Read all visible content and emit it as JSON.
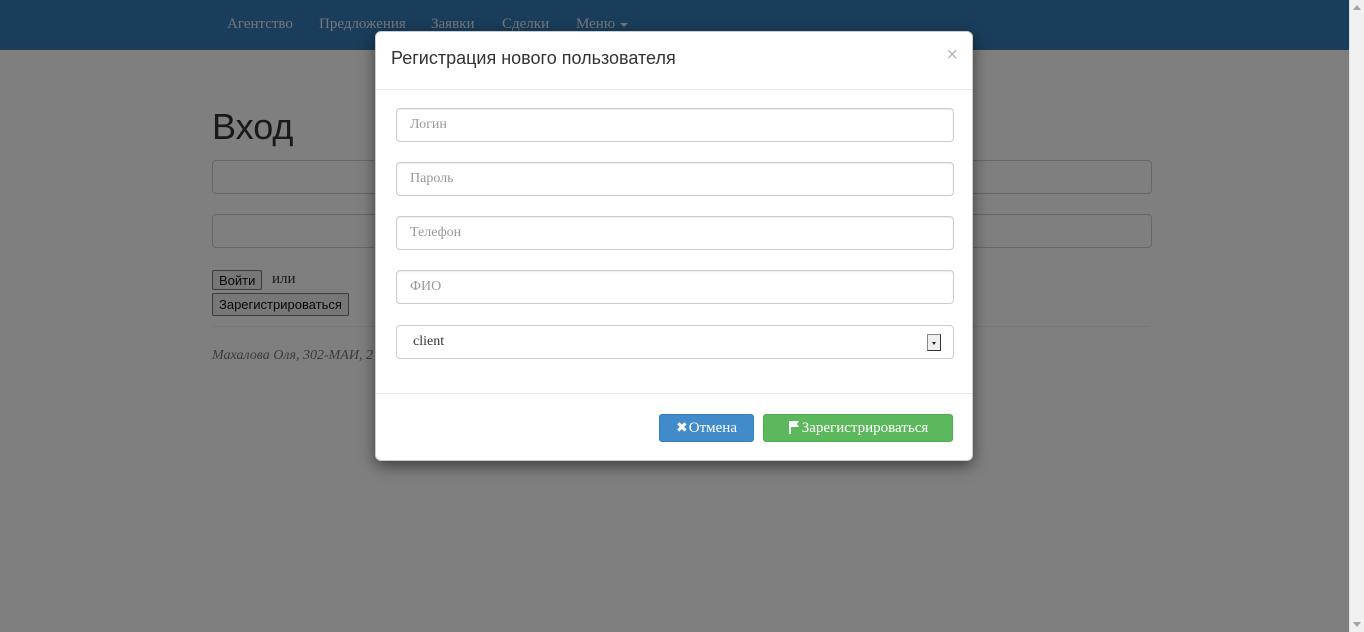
{
  "navbar": {
    "items": [
      "Агентство",
      "Предложения",
      "Заявки",
      "Сделки",
      "Меню"
    ]
  },
  "page": {
    "title": "Вход",
    "login_button": "Войти",
    "or_text": "или",
    "register_button": "Зарегистрироваться",
    "footer": "Махалова Оля, 302-МАИ, 2"
  },
  "modal": {
    "title": "Регистрация нового пользователя",
    "close_label": "×",
    "fields": {
      "login_placeholder": "Логин",
      "password_placeholder": "Пароль",
      "phone_placeholder": "Телефон",
      "fio_placeholder": "ФИО"
    },
    "role_select": {
      "value": "client"
    },
    "cancel_label": "Отмена",
    "register_label": "Зарегистрироваться"
  },
  "colors": {
    "navbar": "#337ab7",
    "primary": "#428bca",
    "success": "#5cb85c"
  }
}
